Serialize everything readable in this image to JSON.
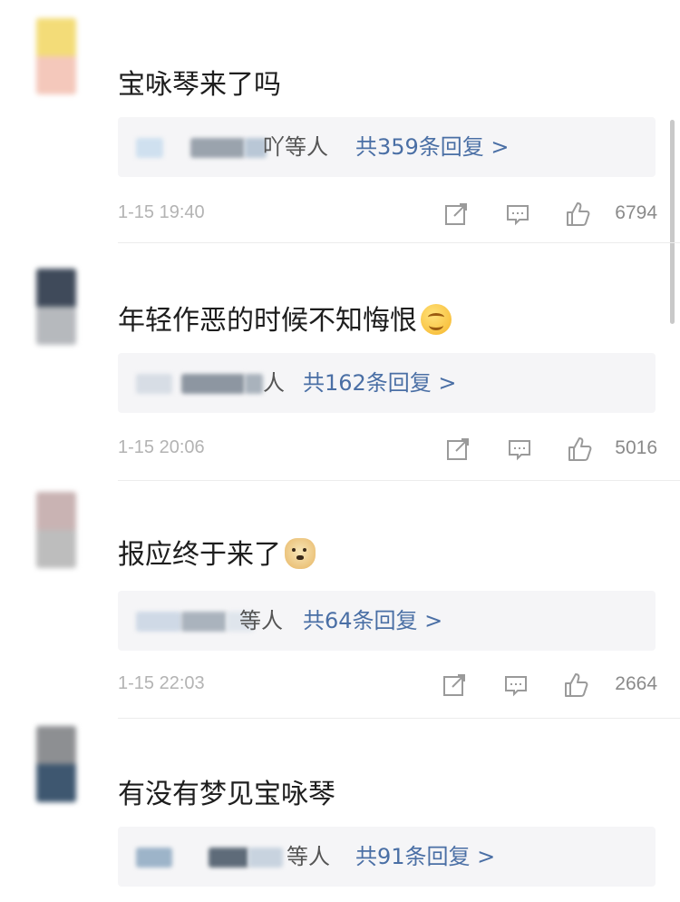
{
  "comments": [
    {
      "text": "宝咏琴来了吗",
      "emoji": "",
      "reply_suffix": "吖等人",
      "reply_count": "共359条回复 >",
      "time": "1-15 19:40",
      "likes": "6794",
      "avatar_colors": [
        "#f3dc78",
        "#f4c8bb"
      ],
      "blur_colors": [
        "#cfe0ef",
        "#9aa3ad",
        "#b9c7d6"
      ]
    },
    {
      "text": "年轻作恶的时候不知悔恨",
      "emoji": "smile-emoji",
      "reply_suffix": "人",
      "reply_count": "共162条回复 >",
      "time": "1-15 20:06",
      "likes": "5016",
      "avatar_colors": [
        "#3f4a5a",
        "#b6b9bd"
      ],
      "blur_colors": [
        "#d7dde5",
        "#8d96a1",
        "#a9b2bc"
      ]
    },
    {
      "text": "报应终于来了",
      "emoji": "doge-emoji",
      "reply_suffix": "等人",
      "reply_count": "共64条回复 >",
      "time": "1-15 22:03",
      "likes": "2664",
      "avatar_colors": [
        "#c9b3b3",
        "#bdbdbd"
      ],
      "blur_colors": [
        "#cfd9e6",
        "#aab3bd",
        "#dfe5ec"
      ]
    },
    {
      "text": "有没有梦见宝咏琴",
      "emoji": "",
      "reply_suffix": "等人",
      "reply_count": "共91条回复 >",
      "time": "",
      "likes": "",
      "avatar_colors": [
        "#8d8f92",
        "#3e5770"
      ],
      "blur_colors": [
        "#9db4c9",
        "#5e6b79",
        "#c8d3df"
      ]
    }
  ],
  "icons": {
    "share": "share-icon",
    "comment": "comment-icon",
    "like": "thumbs-up-icon"
  },
  "colors": {
    "reply_link": "#4a6fa5",
    "reply_box_bg": "#f5f5f7",
    "meta_gray": "#b3b3b3"
  }
}
